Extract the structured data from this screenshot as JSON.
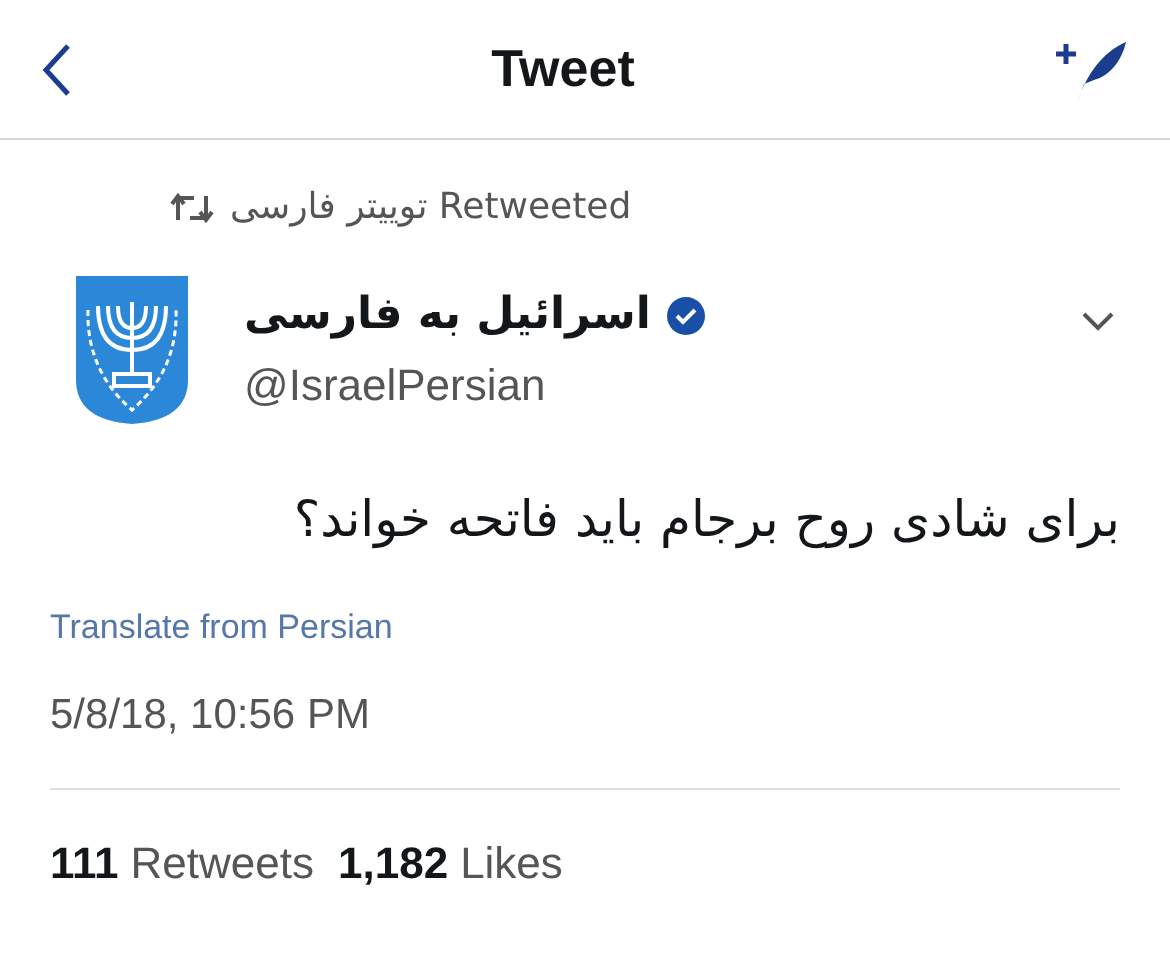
{
  "header": {
    "title": "Tweet"
  },
  "retweeted_by": "توییتر فارسی Retweeted",
  "author": {
    "name": "اسرائیل به فارسی",
    "verified": true,
    "handle": "@IsraelPersian"
  },
  "tweet": {
    "text": "برای شادی روح برجام باید فاتحه خواند؟",
    "translate_link": "Translate from Persian",
    "timestamp": "5/8/18, 10:56 PM"
  },
  "stats": [
    {
      "count": "111",
      "label": "Retweets"
    },
    {
      "count": "1,182",
      "label": "Likes"
    }
  ]
}
